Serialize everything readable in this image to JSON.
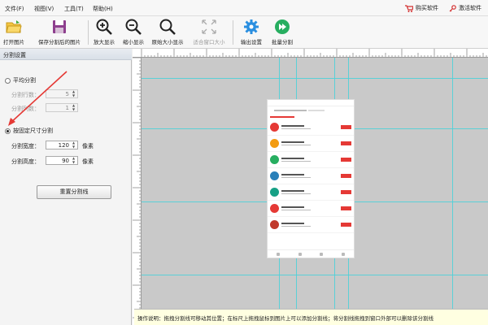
{
  "menu": {
    "file": "文件(F)",
    "view": "视图(V)",
    "tools": "工具(T)",
    "help": "帮助(H)",
    "buy": "购买软件",
    "activate": "激活软件"
  },
  "toolbar": {
    "open": "打开图片",
    "save": "保存分割后的图片",
    "zoom_in": "放大显示",
    "zoom_out": "缩小显示",
    "actual_size": "原始大小显示",
    "fit_window": "适合窗口大小",
    "output_settings": "输出设置",
    "batch_split": "批量分割"
  },
  "panel": {
    "title": "分割设置",
    "average_split": "平均分割",
    "rows_label": "分割行数：",
    "rows_value": "5",
    "cols_label": "分割列数：",
    "cols_value": "1",
    "fixed_split": "按固定尺寸分割",
    "width_label": "分割宽度：",
    "width_value": "120",
    "height_label": "分割高度：",
    "height_value": "90",
    "unit": "像素",
    "reset_button": "重置分割线"
  },
  "status": {
    "text": "操作说明：拖拽分割线可移动其位置；在标尺上拖拽鼠标到图片上可以添加分割线；将分割线拖拽到窗口外部可以删除该分割线"
  },
  "colors": {
    "guide": "#4fd0d8",
    "accent_red": "#e53935",
    "annotation_arrow": "#e53935"
  }
}
